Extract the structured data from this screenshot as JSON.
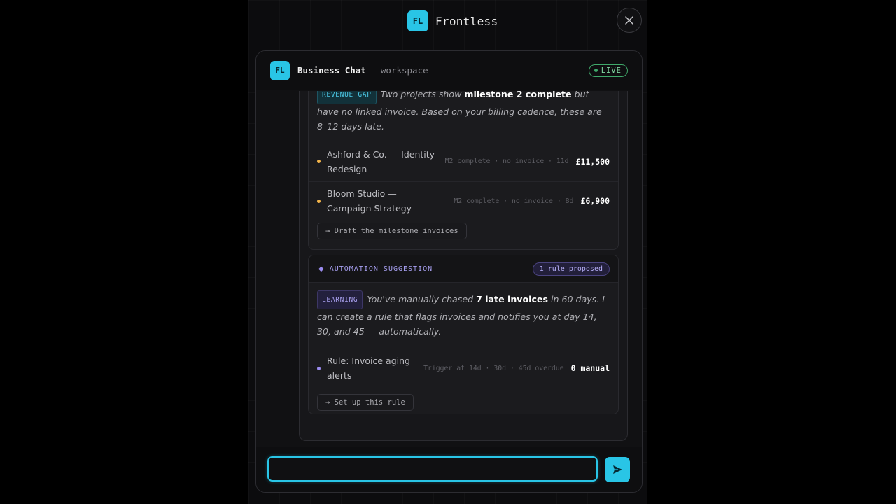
{
  "app": {
    "logo_text": "FL",
    "name": "Frontless",
    "close_icon": "close-icon"
  },
  "chat": {
    "logo_text": "FL",
    "title": "Business Chat",
    "subtitle": "— workspace",
    "status": "LIVE"
  },
  "revenue_card": {
    "tag": "REVENUE GAP",
    "text_pre": "Two projects show",
    "text_bold": "milestone 2 complete",
    "text_post": "but have no linked invoice. Based on your billing cadence, these are 8–12 days late.",
    "rows": [
      {
        "name": "Ashford & Co. — Identity Redesign",
        "meta": "M2 complete · no invoice · 11d",
        "amount": "£11,500"
      },
      {
        "name": "Bloom Studio — Campaign Strategy",
        "meta": "M2 complete · no invoice · 8d",
        "amount": "£6,900"
      }
    ],
    "action": "→ Draft the milestone invoices"
  },
  "automation_card": {
    "icon": "diamond-icon",
    "header": "AUTOMATION SUGGESTION",
    "pill": "1 rule proposed",
    "tag": "LEARNING",
    "text_pre": "You've manually chased",
    "text_bold": "7 late invoices",
    "text_post": "in 60 days. I can create a rule that flags invoices and notifies you at day 14, 30, and 45 — automatically.",
    "rows": [
      {
        "name": "Rule: Invoice aging alerts",
        "meta": "Trigger at 14d · 30d · 45d overdue",
        "amount": "0 manual"
      }
    ],
    "action": "→ Set up this rule"
  },
  "composer": {
    "value": "",
    "placeholder": "",
    "send_icon": "send-icon"
  },
  "colors": {
    "accent": "#29c5e6",
    "live": "#3fa86a",
    "amber": "#f2b44a",
    "violet": "#9b8cf0"
  }
}
